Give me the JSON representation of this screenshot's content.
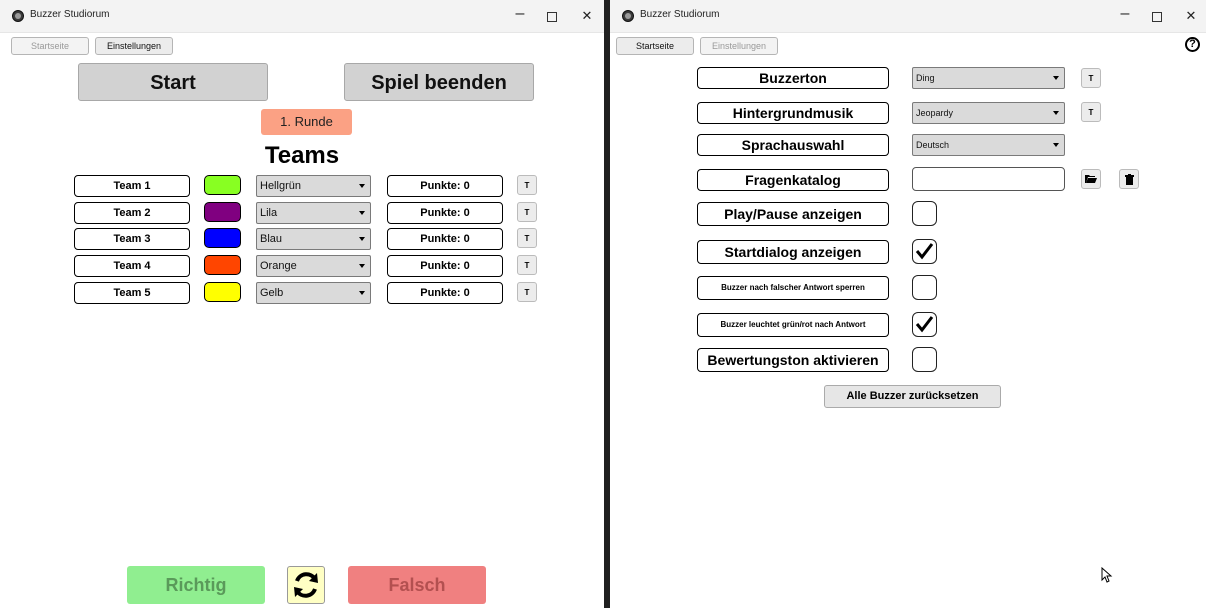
{
  "left_window": {
    "title": "Buzzer Studiorum",
    "nav": {
      "startseite": "Startseite",
      "einstellungen": "Einstellungen"
    },
    "start_label": "Start",
    "end_label": "Spiel beenden",
    "round_label": "1. Runde",
    "teams_heading": "Teams",
    "teams": [
      {
        "name": "Team 1",
        "color": "#88ff22",
        "color_name": "Hellgrün",
        "points": "Punkte: 0",
        "t_label": "T"
      },
      {
        "name": "Team 2",
        "color": "#800080",
        "color_name": "Lila",
        "points": "Punkte: 0",
        "t_label": "T"
      },
      {
        "name": "Team 3",
        "color": "#0000ff",
        "color_name": "Blau",
        "points": "Punkte: 0",
        "t_label": "T"
      },
      {
        "name": "Team 4",
        "color": "#ff4500",
        "color_name": "Orange",
        "points": "Punkte: 0",
        "t_label": "T"
      },
      {
        "name": "Team 5",
        "color": "#ffff00",
        "color_name": "Gelb",
        "points": "Punkte: 0",
        "t_label": "T"
      }
    ],
    "correct_label": "Richtig",
    "wrong_label": "Falsch"
  },
  "right_window": {
    "title": "Buzzer Studiorum",
    "nav": {
      "startseite": "Startseite",
      "einstellungen": "Einstellungen"
    },
    "help_glyph": "?",
    "buzzer_tone": {
      "label": "Buzzerton",
      "value": "Ding",
      "t_label": "T"
    },
    "background_music": {
      "label": "Hintergrundmusik",
      "value": "Jeopardy",
      "t_label": "T"
    },
    "language": {
      "label": "Sprachauswahl",
      "value": "Deutsch"
    },
    "question_catalog": {
      "label": "Fragenkatalog",
      "value": ""
    },
    "checkboxes": [
      {
        "label": "Play/Pause anzeigen",
        "checked": false
      },
      {
        "label": "Startdialog anzeigen",
        "checked": true
      },
      {
        "label": "Buzzer nach falscher Antwort sperren",
        "checked": false
      },
      {
        "label": "Buzzer leuchtet grün/rot nach Antwort",
        "checked": true
      },
      {
        "label": "Bewertungston aktivieren",
        "checked": false
      }
    ],
    "reset_label": "Alle Buzzer zurücksetzen"
  }
}
